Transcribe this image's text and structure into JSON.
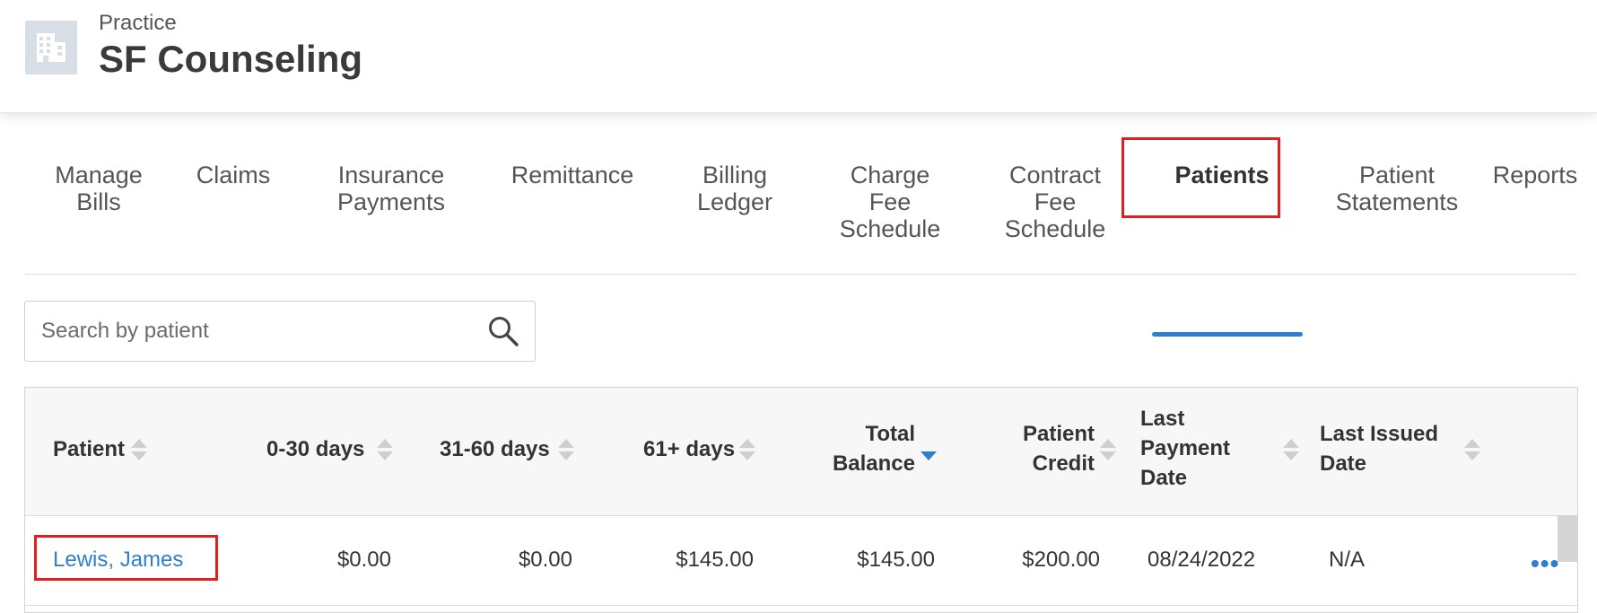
{
  "header": {
    "kicker": "Practice",
    "name": "SF Counseling",
    "icon": "building-icon"
  },
  "tabs": [
    {
      "label": "Manage Bills"
    },
    {
      "label": "Claims"
    },
    {
      "label": "Insurance Payments"
    },
    {
      "label": "Remittance"
    },
    {
      "label": "Billing Ledger"
    },
    {
      "label": "Charge Fee Schedule"
    },
    {
      "label": "Contract Fee Schedule"
    },
    {
      "label": "Patients",
      "active": true
    },
    {
      "label": "Patient Statements"
    },
    {
      "label": "Reports"
    }
  ],
  "search": {
    "placeholder": "Search by patient",
    "icon": "search-icon"
  },
  "table": {
    "columns": [
      "Patient",
      "0-30 days",
      "31-60 days",
      "61+ days",
      "Total Balance",
      "Patient Credit",
      "Last Payment Date",
      "Last Issued Date"
    ],
    "sorted_column": "Total Balance",
    "sort_direction": "descending",
    "rows": [
      {
        "patient": "Lewis, James",
        "d0_30": "$0.00",
        "d31_60": "$0.00",
        "d61_plus": "$145.00",
        "total_balance": "$145.00",
        "patient_credit": "$200.00",
        "last_payment_date": "08/24/2022",
        "last_issued_date": "N/A",
        "actions_icon": "more-dots-icon"
      }
    ]
  },
  "colors": {
    "accent": "#2f7fcf",
    "highlight": "#e02020"
  }
}
